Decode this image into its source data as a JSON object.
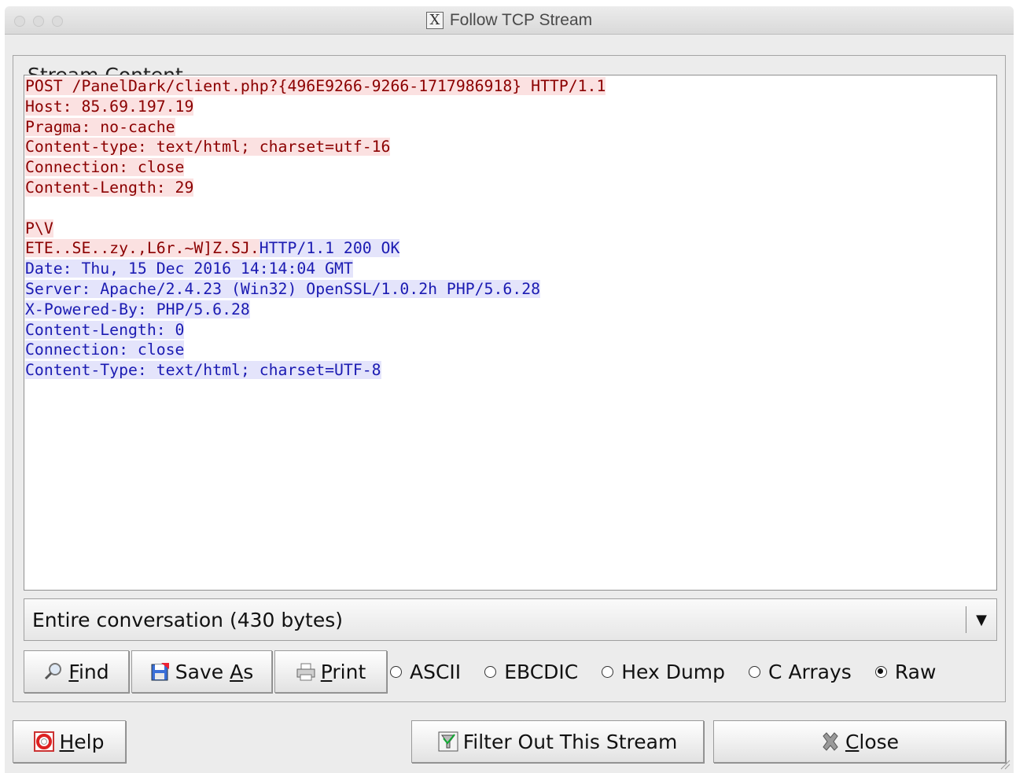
{
  "window": {
    "title": "Follow TCP Stream",
    "app_icon": "x11-icon"
  },
  "group": {
    "title": "Stream Content"
  },
  "stream": {
    "lines": [
      {
        "parts": [
          {
            "text": "POST /PanelDark/client.php?{496E9266-9266-1717986918} HTTP/1.1",
            "dir": "client"
          }
        ]
      },
      {
        "parts": [
          {
            "text": "Host: 85.69.197.19",
            "dir": "client"
          }
        ]
      },
      {
        "parts": [
          {
            "text": "Pragma: no-cache",
            "dir": "client"
          }
        ]
      },
      {
        "parts": [
          {
            "text": "Content-type: text/html; charset=utf-16",
            "dir": "client"
          }
        ]
      },
      {
        "parts": [
          {
            "text": "Connection: close",
            "dir": "client"
          }
        ]
      },
      {
        "parts": [
          {
            "text": "Content-Length: 29",
            "dir": "client"
          }
        ]
      },
      {
        "parts": []
      },
      {
        "parts": [
          {
            "text": "P\\V",
            "dir": "client"
          }
        ]
      },
      {
        "parts": [
          {
            "text": "ETE..SE..zy.,L6r.~W]Z.SJ.",
            "dir": "client"
          },
          {
            "text": "HTTP/1.1 200 OK",
            "dir": "server"
          }
        ]
      },
      {
        "parts": [
          {
            "text": "Date: Thu, 15 Dec 2016 14:14:04 GMT",
            "dir": "server"
          }
        ]
      },
      {
        "parts": [
          {
            "text": "Server: Apache/2.4.23 (Win32) OpenSSL/1.0.2h PHP/5.6.28",
            "dir": "server"
          }
        ]
      },
      {
        "parts": [
          {
            "text": "X-Powered-By: PHP/5.6.28",
            "dir": "server"
          }
        ]
      },
      {
        "parts": [
          {
            "text": "Content-Length: 0",
            "dir": "server"
          }
        ]
      },
      {
        "parts": [
          {
            "text": "Connection: close",
            "dir": "server"
          }
        ]
      },
      {
        "parts": [
          {
            "text": "Content-Type: text/html; charset=UTF-8",
            "dir": "server"
          }
        ]
      }
    ],
    "colors": {
      "client_text": "#8b0000",
      "client_bg": "#fbe1e1",
      "server_text": "#1b1bb2",
      "server_bg": "#e4e4fb"
    }
  },
  "conversation_select": {
    "value": "Entire conversation (430 bytes)"
  },
  "toolbar": {
    "find": {
      "label_underlined": "F",
      "label_rest": "ind",
      "icon": "magnifier-icon"
    },
    "save_as": {
      "label_pre": "Save ",
      "label_underlined": "A",
      "label_rest": "s",
      "icon": "save-icon"
    },
    "print": {
      "label_underlined": "P",
      "label_rest": "rint",
      "icon": "printer-icon"
    }
  },
  "formats": [
    {
      "label": "ASCII",
      "selected": false
    },
    {
      "label": "EBCDIC",
      "selected": false
    },
    {
      "label": "Hex Dump",
      "selected": false
    },
    {
      "label": "C Arrays",
      "selected": false
    },
    {
      "label": "Raw",
      "selected": true
    }
  ],
  "footer": {
    "help": {
      "label_underlined": "H",
      "label_rest": "elp",
      "icon": "lifebuoy-icon"
    },
    "filter_out": {
      "label": "Filter Out This Stream",
      "icon": "filter-icon"
    },
    "close": {
      "label_underlined": "C",
      "label_rest": "lose",
      "icon": "close-x-icon"
    }
  }
}
